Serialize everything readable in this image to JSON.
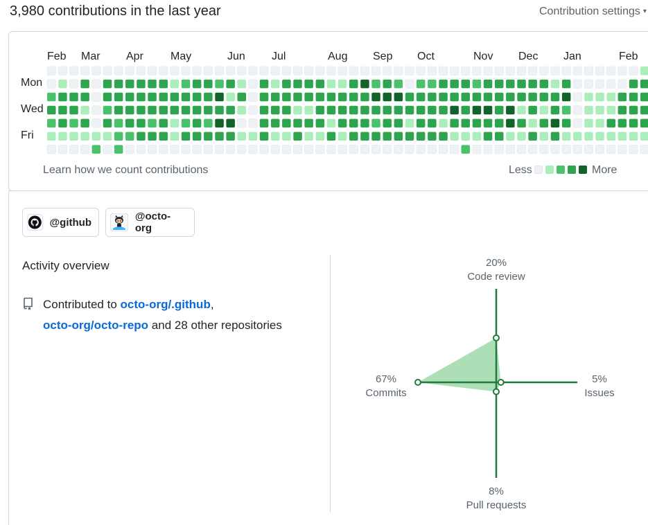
{
  "header": {
    "title": "3,980 contributions in the last year",
    "settings_label": "Contribution settings",
    "settings_caret": "▾"
  },
  "calendar": {
    "months": [
      "Feb",
      "Mar",
      "Apr",
      "May",
      "Jun",
      "Jul",
      "Aug",
      "Sep",
      "Oct",
      "Nov",
      "Dec",
      "Jan",
      "Feb"
    ],
    "day_labels": [
      "Mon",
      "Wed",
      "Fri"
    ],
    "weeks": [
      [
        0,
        0,
        2,
        3,
        2,
        1,
        0
      ],
      [
        0,
        1,
        3,
        3,
        3,
        1,
        0
      ],
      [
        0,
        0,
        3,
        3,
        2,
        1,
        0
      ],
      [
        0,
        3,
        3,
        1,
        3,
        1,
        0
      ],
      [
        0,
        0,
        0,
        0,
        0,
        1,
        2
      ],
      [
        0,
        3,
        3,
        2,
        3,
        1,
        0
      ],
      [
        0,
        3,
        3,
        3,
        2,
        2,
        2
      ],
      [
        0,
        3,
        3,
        3,
        3,
        2,
        0
      ],
      [
        0,
        3,
        3,
        3,
        3,
        3,
        0
      ],
      [
        0,
        3,
        3,
        3,
        2,
        3,
        0
      ],
      [
        0,
        3,
        3,
        3,
        3,
        3,
        0
      ],
      [
        0,
        1,
        3,
        3,
        1,
        1,
        0
      ],
      [
        0,
        2,
        3,
        3,
        2,
        3,
        0
      ],
      [
        0,
        3,
        3,
        3,
        3,
        3,
        0
      ],
      [
        0,
        3,
        3,
        3,
        2,
        3,
        0
      ],
      [
        0,
        2,
        4,
        3,
        4,
        3,
        0
      ],
      [
        0,
        3,
        1,
        3,
        4,
        3,
        0
      ],
      [
        0,
        1,
        3,
        1,
        0,
        1,
        0
      ],
      [
        0,
        0,
        0,
        0,
        0,
        1,
        0
      ],
      [
        0,
        3,
        3,
        3,
        3,
        3,
        0
      ],
      [
        0,
        1,
        3,
        3,
        3,
        1,
        0
      ],
      [
        0,
        3,
        3,
        3,
        3,
        1,
        0
      ],
      [
        0,
        3,
        3,
        1,
        3,
        3,
        0
      ],
      [
        0,
        3,
        3,
        1,
        3,
        1,
        0
      ],
      [
        0,
        3,
        3,
        3,
        3,
        1,
        0
      ],
      [
        0,
        1,
        3,
        3,
        1,
        3,
        0
      ],
      [
        0,
        1,
        3,
        3,
        3,
        1,
        0
      ],
      [
        0,
        3,
        3,
        3,
        3,
        3,
        0
      ],
      [
        0,
        4,
        3,
        3,
        3,
        3,
        0
      ],
      [
        0,
        2,
        4,
        3,
        2,
        3,
        0
      ],
      [
        0,
        3,
        4,
        3,
        3,
        3,
        0
      ],
      [
        0,
        2,
        4,
        3,
        3,
        3,
        0
      ],
      [
        0,
        0,
        3,
        3,
        1,
        3,
        0
      ],
      [
        0,
        2,
        3,
        3,
        3,
        3,
        0
      ],
      [
        0,
        2,
        3,
        3,
        3,
        3,
        0
      ],
      [
        0,
        3,
        3,
        3,
        1,
        3,
        0
      ],
      [
        0,
        3,
        3,
        4,
        3,
        1,
        0
      ],
      [
        0,
        3,
        3,
        3,
        3,
        1,
        2
      ],
      [
        0,
        2,
        3,
        4,
        3,
        1,
        0
      ],
      [
        0,
        3,
        3,
        4,
        3,
        3,
        0
      ],
      [
        0,
        3,
        3,
        3,
        3,
        3,
        0
      ],
      [
        0,
        3,
        3,
        4,
        4,
        1,
        0
      ],
      [
        0,
        3,
        3,
        1,
        3,
        1,
        0
      ],
      [
        0,
        3,
        3,
        3,
        1,
        3,
        0
      ],
      [
        0,
        3,
        3,
        1,
        3,
        1,
        0
      ],
      [
        0,
        1,
        3,
        3,
        4,
        3,
        0
      ],
      [
        0,
        3,
        4,
        2,
        3,
        1,
        0
      ],
      [
        0,
        0,
        0,
        0,
        0,
        1,
        0
      ],
      [
        0,
        0,
        1,
        1,
        1,
        1,
        0
      ],
      [
        0,
        0,
        1,
        1,
        1,
        1,
        0
      ],
      [
        0,
        0,
        1,
        1,
        3,
        1,
        0
      ],
      [
        0,
        0,
        3,
        3,
        3,
        1,
        0
      ],
      [
        0,
        3,
        3,
        3,
        3,
        1,
        0
      ],
      [
        1,
        3,
        3,
        3,
        3,
        1,
        0
      ]
    ]
  },
  "learn_link": "Learn how we count contributions",
  "legend": {
    "less": "Less",
    "more": "More"
  },
  "orgs": [
    {
      "label": "@github",
      "icon": "github-icon"
    },
    {
      "label": "@octo-org",
      "icon": "octocat-icon"
    }
  ],
  "activity": {
    "title": "Activity overview",
    "contributed_prefix": "Contributed to",
    "repo1": "octo-org/.github",
    "comma": ",",
    "repo2": "octo-org/octo-repo",
    "suffix": "and 28 other repositories"
  },
  "radar": {
    "top": {
      "percent": "20%",
      "label": "Code review",
      "value": 20
    },
    "right": {
      "percent": "5%",
      "label": "Issues",
      "value": 5
    },
    "bottom": {
      "percent": "8%",
      "label": "Pull requests",
      "value": 8
    },
    "left": {
      "percent": "67%",
      "label": "Commits",
      "value": 67
    }
  },
  "colors": {
    "level0": "#eff2f5",
    "level1": "#aceebb",
    "level2": "#4ac26b",
    "level3": "#2da44e",
    "level4": "#116329",
    "link": "#0969da",
    "radar_line": "#1f7a3c",
    "radar_fill": "#a3dcae"
  }
}
